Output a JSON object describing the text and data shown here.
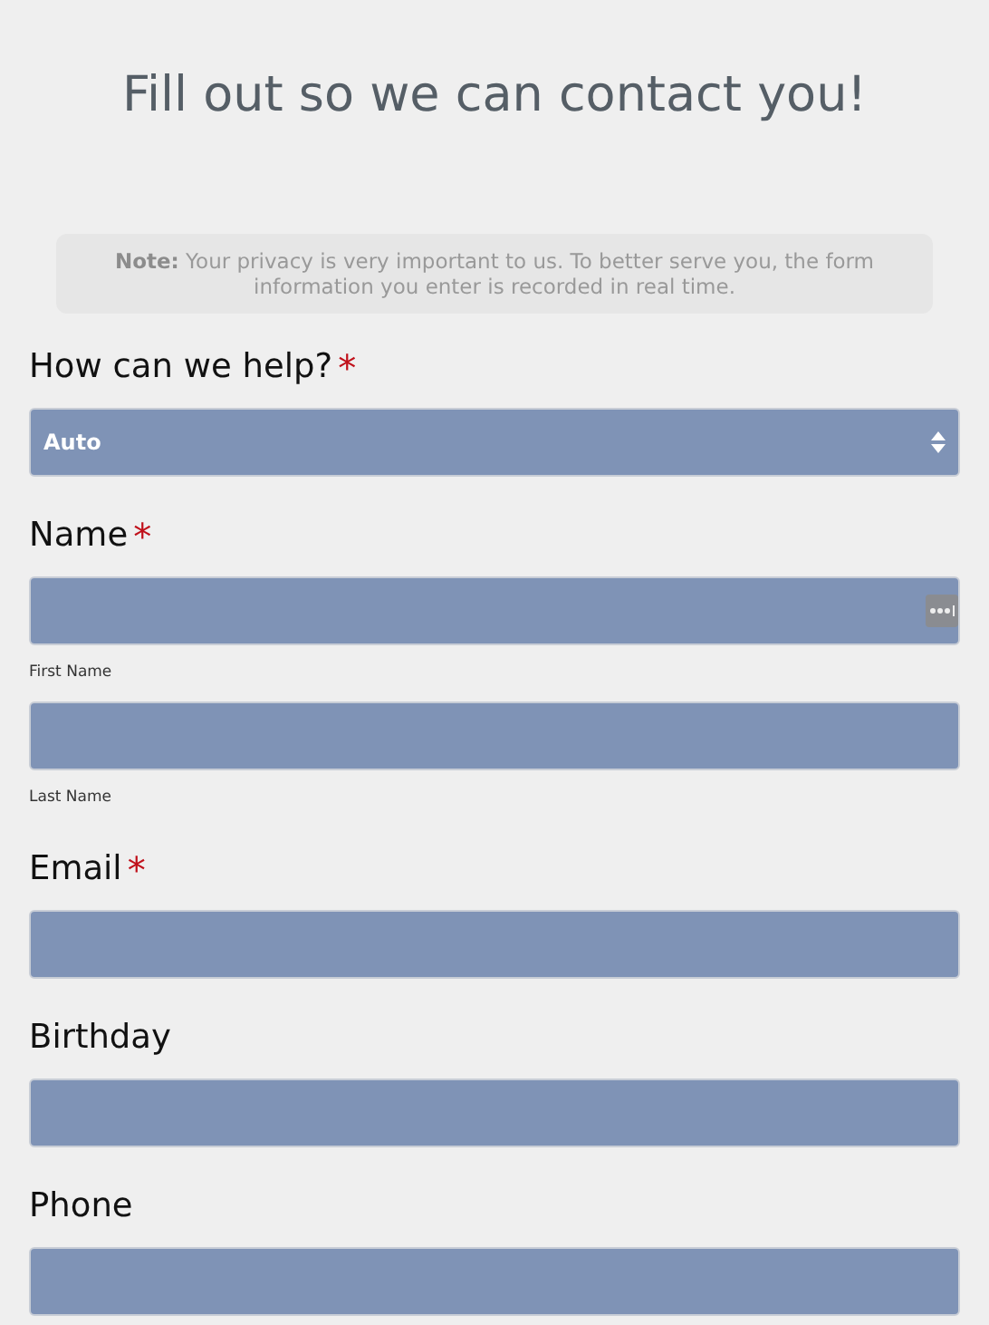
{
  "title": "Fill out so we can contact you!",
  "note": "**Note:** Your privacy is very important to us. To better serve you, the form information you enter is recorded in real time.",
  "fields": [
    {
      "kind": "select",
      "label": "How can we help?",
      "required_mark": "*",
      "value": "Auto"
    },
    {
      "kind": "group",
      "label": "Name",
      "required_mark": "*",
      "parts": [
        {
          "sublabel": "First Name",
          "autofill_icon": true
        },
        {
          "sublabel": "Last Name",
          "autofill_icon": false
        }
      ]
    },
    {
      "kind": "input",
      "label": "Email",
      "required_mark": "*"
    },
    {
      "kind": "input",
      "label": "Birthday"
    },
    {
      "kind": "input",
      "label": "Phone"
    }
  ]
}
